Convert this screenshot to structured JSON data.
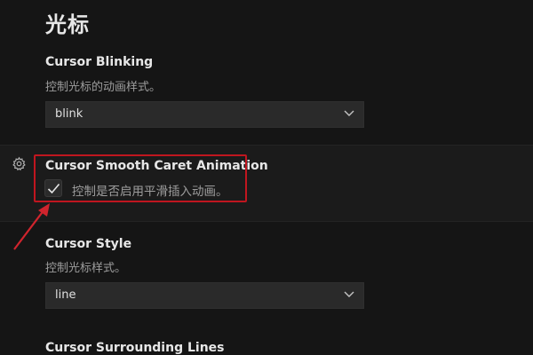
{
  "section": {
    "title": "光标"
  },
  "settings": {
    "blinking": {
      "title": "Cursor Blinking",
      "description": "控制光标的动画样式。",
      "value": "blink"
    },
    "smooth_caret": {
      "title": "Cursor Smooth Caret Animation",
      "description": "控制是否启用平滑插入动画。",
      "checked": true
    },
    "style": {
      "title": "Cursor Style",
      "description": "控制光标样式。",
      "value": "line"
    },
    "surrounding": {
      "title": "Cursor Surrounding Lines"
    }
  },
  "colors": {
    "background": "#151515",
    "highlight": "#c0161f",
    "annotation_arrow": "#d0242d"
  },
  "icons": {
    "gear": "gear-icon",
    "chevron": "chevron-down-icon",
    "check": "check-icon"
  }
}
